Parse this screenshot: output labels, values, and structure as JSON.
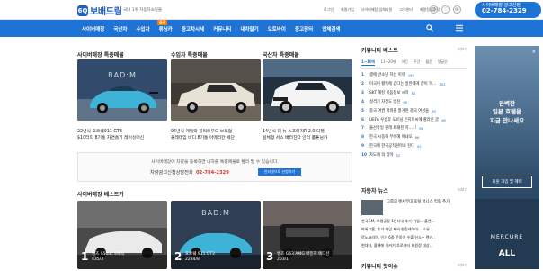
{
  "header": {
    "logo_mark": "6Q",
    "logo_text": "보배드림",
    "tagline": "국내 1위 자동차쇼핑몰",
    "links": [
      "로그인",
      "회원가입",
      "사이버매장 업체회원",
      "고객센터",
      "회원정보수정"
    ],
    "icons": [
      "person-icon",
      "heart-icon",
      "bell-icon"
    ],
    "phone_label": "사이버매장 광고신청",
    "phone_number": "02-784-2329"
  },
  "nav": {
    "items": [
      "사이버매장",
      "국산차",
      "수입차",
      "튜닝카",
      "중고차시세",
      "커뮤니티",
      "내차팔기",
      "오토바이",
      "중고장터",
      "업체검색"
    ],
    "badge": "신규",
    "search_icon": "search-icon",
    "menu_icon": "menu-icon"
  },
  "featured": {
    "sections": [
      {
        "title": "사이버매장 특중매물",
        "caption_title": "22년식 포르쉐911 GT3",
        "caption_sub": "$10터익 8기통 자연흡기 레이싱머신",
        "colors": [
          "#1e3a5f",
          "#3bb1d6",
          "#9ec6d9"
        ]
      },
      {
        "title": "수입차 특중매물",
        "caption_title": "96년식 캐딜락 플리트우드 브로엄",
        "caption_sub": "풀레데임 바디 8기통 아메리칸 세단",
        "colors": [
          "#2a2a2a",
          "#d8d0c4",
          "#8b7e6e"
        ]
      },
      {
        "title": "국산차 특중매물",
        "caption_title": "14년식 더 뉴 스포티지R 2.0 디젤",
        "caption_sub": "일체형 서스 배터진다 인터 품튜닝카",
        "colors": [
          "#1a2430",
          "#f2f2f2",
          "#6b8a9a"
        ]
      }
    ]
  },
  "ad_box": {
    "line1": "사이버매장에 차량을 등록하면 내차를 특중매물로 빨리 팔 수 있습니다.",
    "line2": "차량광고신청상담전화",
    "phone": "02-784-2329",
    "button": "인터넷으로 신청하기"
  },
  "best": {
    "title": "사이버매장 베스트카",
    "items": [
      {
        "rank": "1",
        "name": "벤츠 S500L 4매틱",
        "views": "435/3"
      },
      {
        "rank": "2",
        "name": "포르쉐 911 GT3",
        "views": "2234/8"
      },
      {
        "rank": "3",
        "name": "벤츠 G63 AMG 마진치 에디션",
        "views": "203/1"
      }
    ]
  },
  "community": {
    "title": "커뮤니티 베스트",
    "more": "더보기",
    "tabs": [
      "1~10위",
      "11~20위",
      "야간",
      "주간",
      "월간",
      "댓글순"
    ],
    "rows": [
      {
        "n": "1",
        "text": "생애 반소년 하는 이유",
        "count": "193"
      },
      {
        "n": "2",
        "text": "미국이 황폭에 갔다는 일본에게 갈이 득...",
        "count": "103"
      },
      {
        "n": "3",
        "text": "SKT 해킹 복음정보 시작",
        "count": "82"
      },
      {
        "n": "4",
        "text": "성격기 자전도 방진",
        "count": "90"
      },
      {
        "n": "5",
        "text": "중국 여권 파워를 잘게된 중국 여성들",
        "count": "90"
      },
      {
        "n": "6",
        "text": "UEFA 우승후 도르님 인지파씨에 졸라온 글",
        "count": "46"
      },
      {
        "n": "7",
        "text": "울산유일 원래 폐쇄된 지.....!",
        "count": "66"
      },
      {
        "n": "8",
        "text": "한국 시동해 무례해 아내오",
        "count": "66"
      },
      {
        "n": "9",
        "text": "한국에 한국공직원마로 진다",
        "count": "61"
      },
      {
        "n": "10",
        "text": "차도에 의 잡아",
        "count": "52"
      }
    ]
  },
  "news": {
    "title": "자동차 뉴스",
    "more": "더보기",
    "headline": "그룹의 벤서부대 포털 어니스 킥링 추가",
    "rows": [
      "한국GM, 부평공장 1인터내 추가 취업... 플랜...",
      "파워그룹, 추가 매입 제외 한진레이아... 소유...",
      "르노코리아, 인가 6중 운동이 수출 신소~ 렌카..",
      "현대차, 올해애 이커기 추로카터 회원정 대상..."
    ]
  },
  "community2": {
    "title": "커뮤니티 핫이슈",
    "more": "더보기"
  },
  "sidebar_ad": {
    "line1": "완벽한",
    "line2": "일본 호텔을",
    "line3": "지금 만나세요",
    "button": "회원 가입 및 혜택",
    "brand1": "MERCURE",
    "brand2": "ALL",
    "close": "✕"
  }
}
